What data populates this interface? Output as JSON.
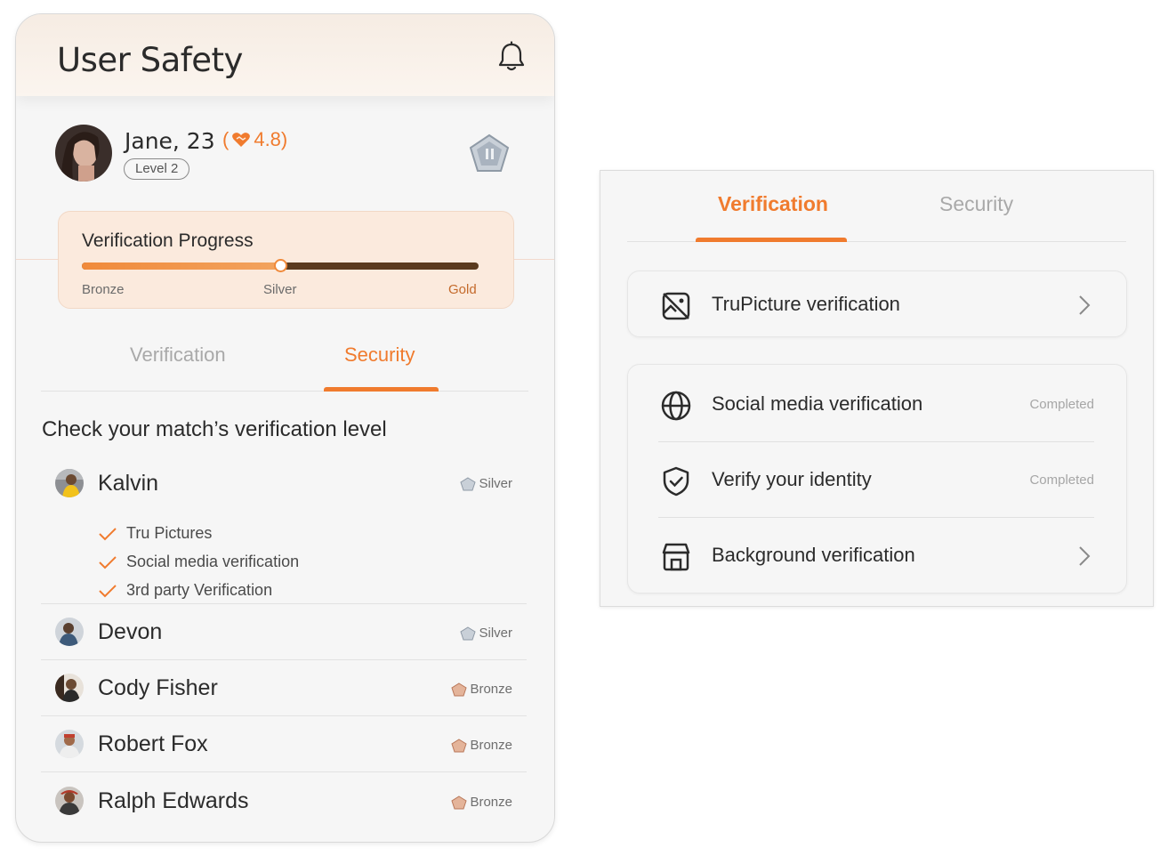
{
  "app": {
    "title": "User Safety"
  },
  "profile": {
    "name": "Jane, 23",
    "rating_open": "(",
    "rating": "4.8",
    "rating_close": ")",
    "level": "Level 2",
    "badge_icon": "silver-shield-icon"
  },
  "progress": {
    "title": "Verification Progress",
    "value_fraction": 0.5,
    "tiers": [
      "Bronze",
      "Silver",
      "Gold"
    ]
  },
  "tabs": {
    "verification": "Verification",
    "security": "Security",
    "active": "security"
  },
  "matches": {
    "heading": "Check your match’s verification level",
    "items": [
      {
        "name": "Kalvin",
        "tier": "Silver",
        "checks": [
          "Tru Pictures",
          "Social media verification",
          "3rd party Verification"
        ]
      },
      {
        "name": "Devon",
        "tier": "Silver"
      },
      {
        "name": "Cody Fisher",
        "tier": "Bronze"
      },
      {
        "name": "Robert Fox",
        "tier": "Bronze"
      },
      {
        "name": "Ralph Edwards",
        "tier": "Bronze"
      }
    ]
  },
  "panel": {
    "tabs": {
      "verification": "Verification",
      "security": "Security",
      "active": "verification"
    },
    "items": [
      {
        "label": "TruPicture verification",
        "status": "",
        "icon": "picture-off-icon"
      },
      {
        "label": "Social media verification",
        "status": "Completed",
        "icon": "globe-icon"
      },
      {
        "label": "Verify your identity",
        "status": "Completed",
        "icon": "shield-check-icon"
      },
      {
        "label": "Background verification",
        "status": "",
        "icon": "store-icon"
      }
    ]
  },
  "colors": {
    "accent": "#f07b2e",
    "silver": "#9aa6b2",
    "bronze": "#c98a6a"
  }
}
